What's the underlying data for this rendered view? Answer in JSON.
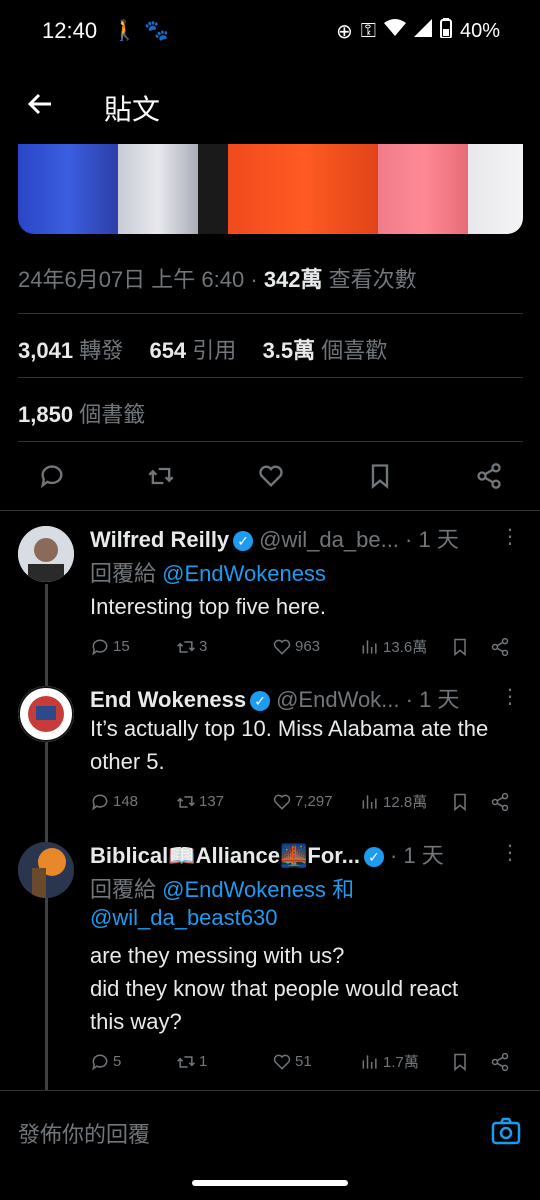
{
  "status_bar": {
    "time": "12:40",
    "battery": "40%"
  },
  "header": {
    "title": "貼文"
  },
  "tweet": {
    "date_time": "24年6月07日 上午 6:40",
    "views_count": "342萬",
    "views_label": "查看次數",
    "retweets_count": "3,041",
    "retweets_label": "轉發",
    "quotes_count": "654",
    "quotes_label": "引用",
    "likes_count": "3.5萬",
    "likes_label": "個喜歡",
    "bookmarks_count": "1,850",
    "bookmarks_label": "個書籤"
  },
  "replies": [
    {
      "name": "Wilfred Reilly",
      "handle": "@wil_da_be...",
      "time": "· 1 天",
      "reply_prefix": "回覆給",
      "reply_to": "@EndWokeness",
      "text": "Interesting top five here.",
      "stats": {
        "replies": "15",
        "retweets": "3",
        "likes": "963",
        "views": "13.6萬"
      }
    },
    {
      "name": "End Wokeness",
      "handle": "@EndWok...",
      "time": "· 1 天",
      "text": "It’s actually top 10. Miss Alabama ate the other 5.",
      "stats": {
        "replies": "148",
        "retweets": "137",
        "likes": "7,297",
        "views": "12.8萬"
      }
    },
    {
      "name": "Biblical📖Alliance🌉For...",
      "time": "· 1 天",
      "reply_prefix": "回覆給",
      "reply_to": "@EndWokeness",
      "reply_and": "和",
      "reply_to_2": "@wil_da_beast630",
      "text_lines": [
        "are they messing with us?",
        "did they know that people would react",
        "this way?"
      ],
      "stats": {
        "replies": "5",
        "retweets": "1",
        "likes": "51",
        "views": "1.7萬"
      }
    }
  ],
  "composer": {
    "placeholder": "發佈你的回覆"
  },
  "colors": {
    "accent": "#1d9bf0",
    "muted": "#71767b",
    "background": "#000000"
  }
}
